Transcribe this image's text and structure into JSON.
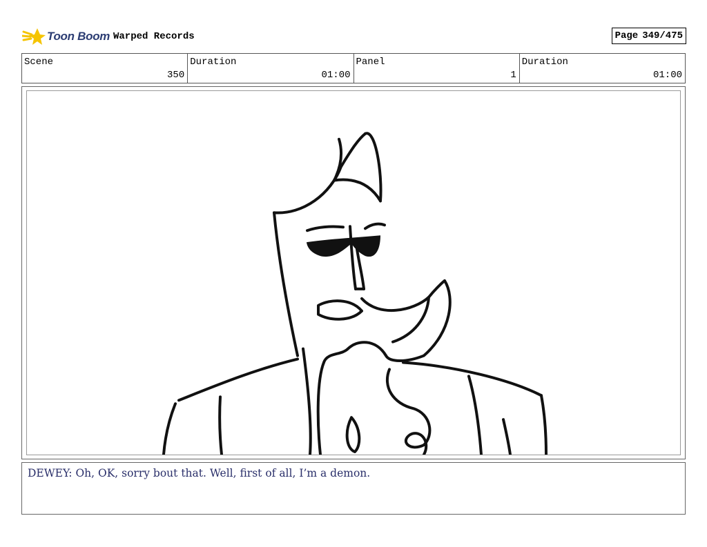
{
  "header": {
    "logo_text": "Toon Boom",
    "project_title": "Warped Records",
    "page_label": "Page",
    "page_number": "349/475"
  },
  "info": {
    "scene_label": "Scene",
    "scene_value": "350",
    "scene_duration_label": "Duration",
    "scene_duration_value": "01:00",
    "panel_label": "Panel",
    "panel_value": "1",
    "panel_duration_label": "Duration",
    "panel_duration_value": "01:00"
  },
  "dialogue": {
    "text": "DEWEY: Oh, OK, sorry bout that. Well, first of all, I’m a demon."
  },
  "colors": {
    "logo_star": "#f5c400",
    "logo_text": "#2c3d73",
    "dialogue_text": "#2a2f6a"
  }
}
